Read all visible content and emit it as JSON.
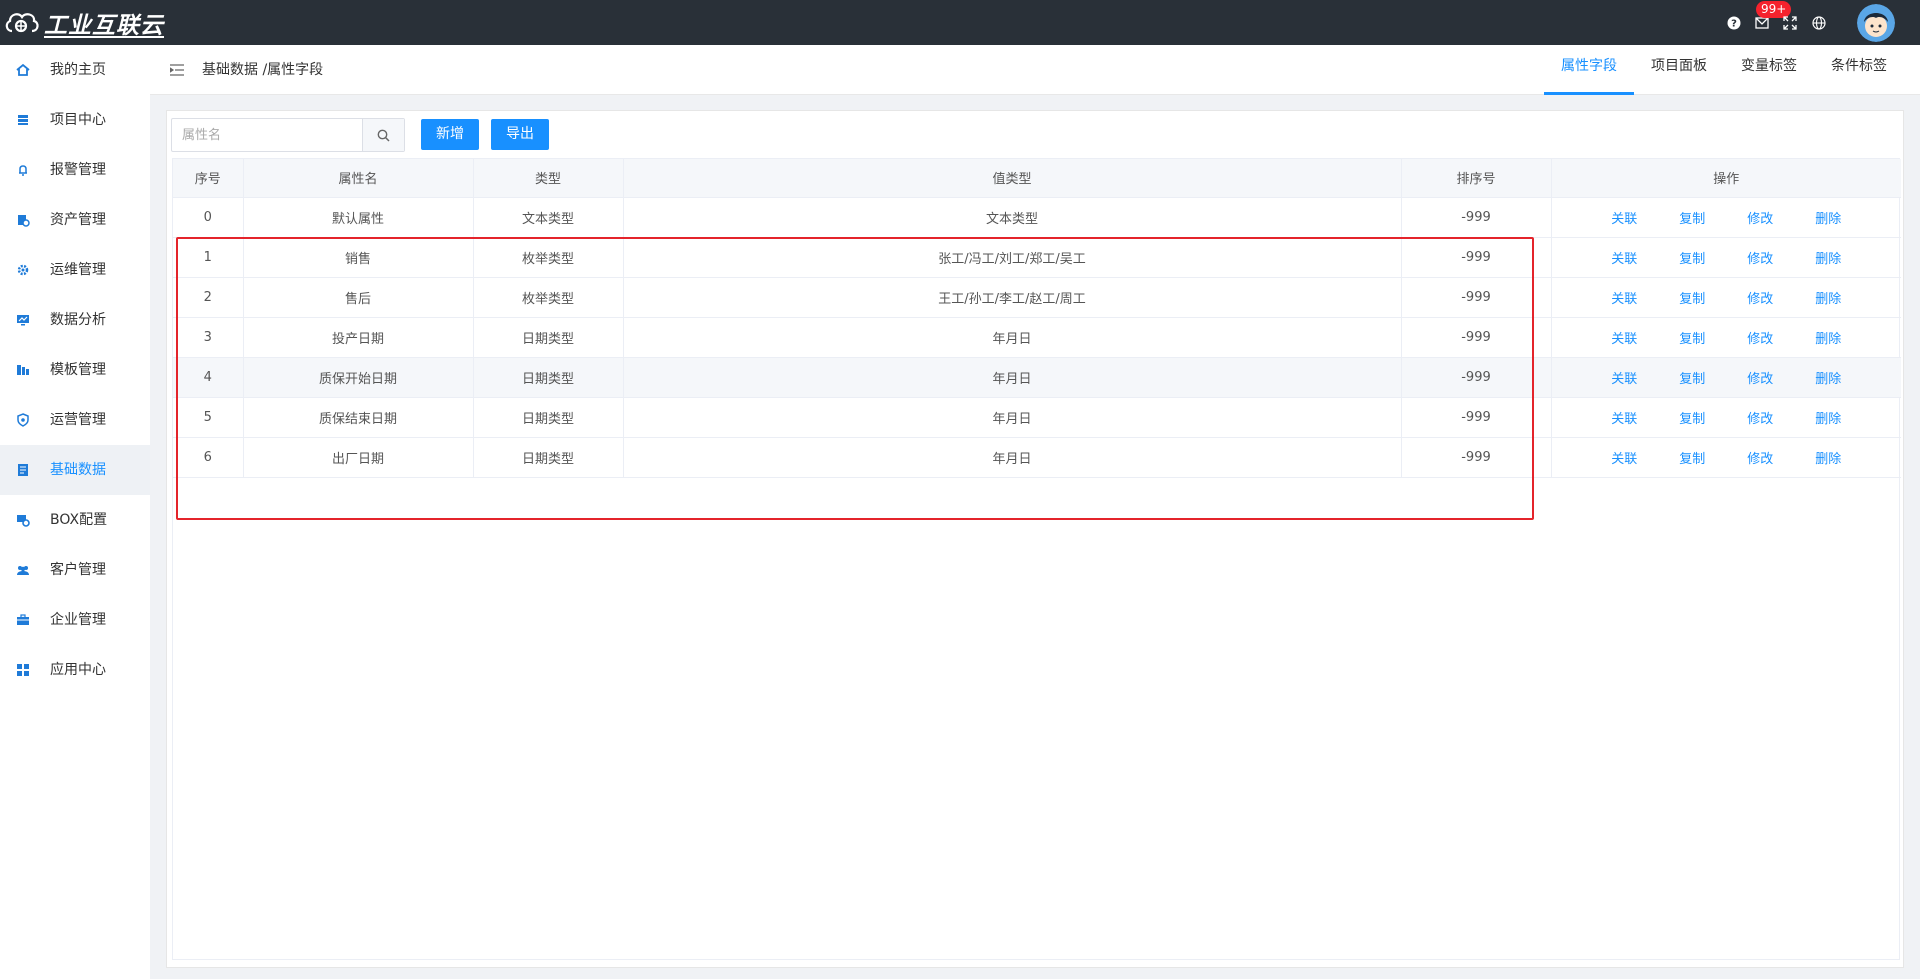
{
  "app": {
    "logo_text": "工业互联云",
    "badge": "99+"
  },
  "sidebar": {
    "items": [
      {
        "label": "我的主页",
        "icon": "home-icon"
      },
      {
        "label": "项目中心",
        "icon": "stack-icon"
      },
      {
        "label": "报警管理",
        "icon": "bell-icon"
      },
      {
        "label": "资产管理",
        "icon": "asset-icon"
      },
      {
        "label": "运维管理",
        "icon": "gear-icon"
      },
      {
        "label": "数据分析",
        "icon": "monitor-chart-icon"
      },
      {
        "label": "模板管理",
        "icon": "template-icon"
      },
      {
        "label": "运营管理",
        "icon": "shield-gear-icon"
      },
      {
        "label": "基础数据",
        "icon": "book-icon",
        "active": true
      },
      {
        "label": "BOX配置",
        "icon": "box-settings-icon"
      },
      {
        "label": "客户管理",
        "icon": "users-icon"
      },
      {
        "label": "企业管理",
        "icon": "briefcase-icon"
      },
      {
        "label": "应用中心",
        "icon": "apps-grid-icon"
      }
    ]
  },
  "header": {
    "breadcrumb": "基础数据 /属性字段",
    "tabs": [
      {
        "label": "属性字段",
        "active": true
      },
      {
        "label": "项目面板"
      },
      {
        "label": "变量标签"
      },
      {
        "label": "条件标签"
      }
    ]
  },
  "toolbar": {
    "search_placeholder": "属性名",
    "add_label": "新增",
    "export_label": "导出"
  },
  "table": {
    "columns": [
      "序号",
      "属性名",
      "类型",
      "值类型",
      "排序号",
      "操作"
    ],
    "actions": [
      "关联",
      "复制",
      "修改",
      "删除"
    ],
    "rows": [
      [
        "0",
        "默认属性",
        "文本类型",
        "文本类型",
        "-999"
      ],
      [
        "1",
        "销售",
        "枚举类型",
        "张工/冯工/刘工/郑工/吴工",
        "-999"
      ],
      [
        "2",
        "售后",
        "枚举类型",
        "王工/孙工/李工/赵工/周工",
        "-999"
      ],
      [
        "3",
        "投产日期",
        "日期类型",
        "年月日",
        "-999"
      ],
      [
        "4",
        "质保开始日期",
        "日期类型",
        "年月日",
        "-999"
      ],
      [
        "5",
        "质保结束日期",
        "日期类型",
        "年月日",
        "-999"
      ],
      [
        "6",
        "出厂日期",
        "日期类型",
        "年月日",
        "-999"
      ]
    ]
  },
  "colors": {
    "primary": "#1890ff",
    "topbar": "#293038",
    "highlight": "#e4242b",
    "badge": "#f5222d"
  }
}
